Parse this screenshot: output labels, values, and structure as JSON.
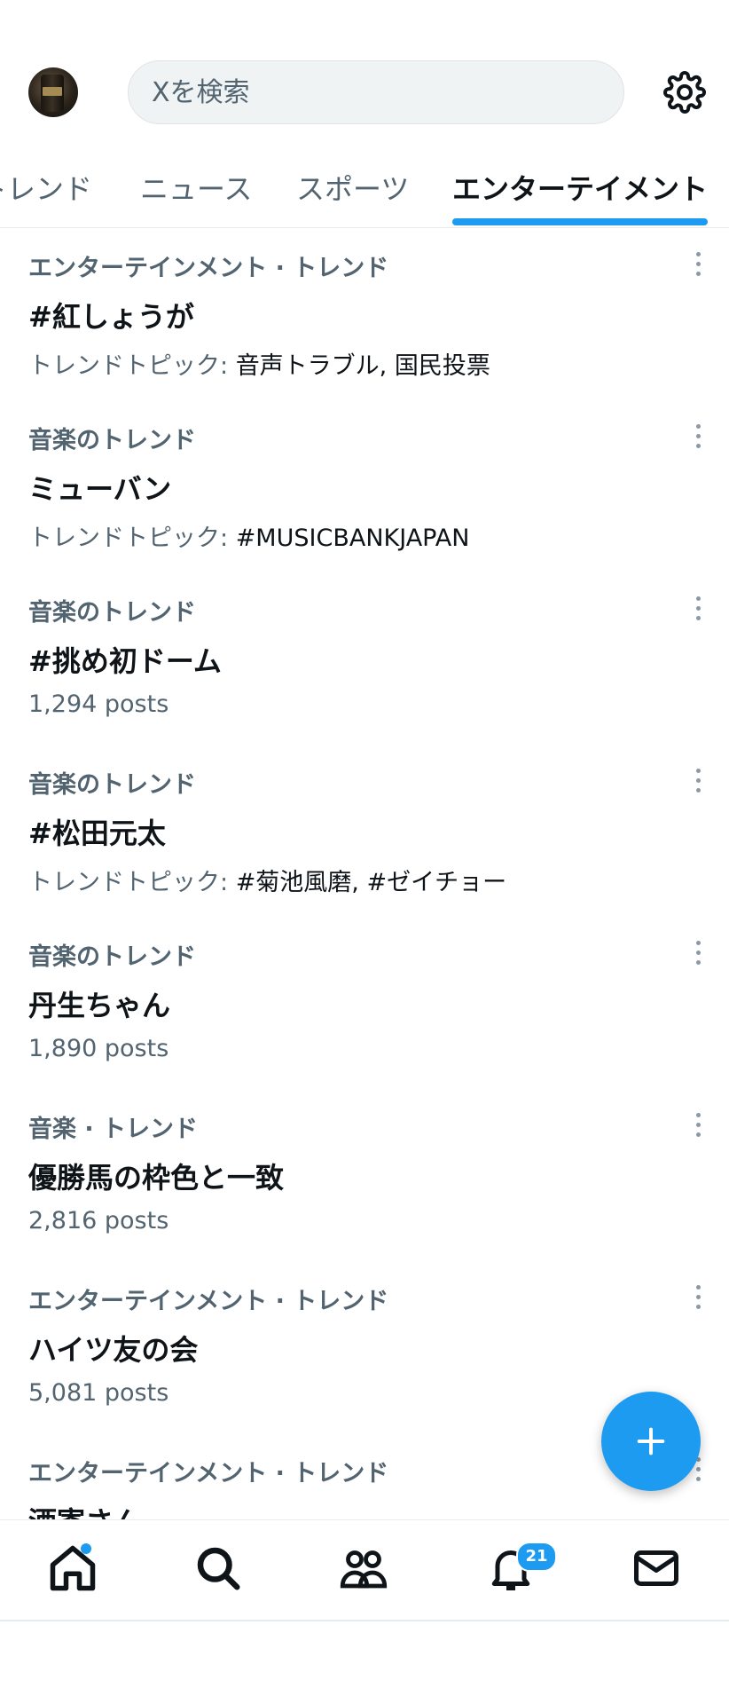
{
  "search": {
    "placeholder": "Xを検索"
  },
  "tabs": [
    {
      "label": "トレンド",
      "visible": "トレンド",
      "active": false
    },
    {
      "label": "ニュース",
      "active": false
    },
    {
      "label": "スポーツ",
      "active": false
    },
    {
      "label": "エンターテイメント",
      "active": true
    }
  ],
  "trends": [
    {
      "category": "エンターテインメント · トレンド",
      "name": "#紅しょうが",
      "meta_prefix": "トレンドトピック: ",
      "meta": "音声トラブル, 国民投票"
    },
    {
      "category": "音楽のトレンド",
      "name": "ミューバン",
      "meta_prefix": "トレンドトピック: ",
      "meta": "#MUSICBANKJAPAN"
    },
    {
      "category": "音楽のトレンド",
      "name": "#挑め初ドーム",
      "meta_prefix": "",
      "meta": "1,294 posts"
    },
    {
      "category": "音楽のトレンド",
      "name": "#松田元太",
      "meta_prefix": "トレンドトピック: ",
      "meta": "#菊池風磨, #ゼイチョー"
    },
    {
      "category": "音楽のトレンド",
      "name": "丹生ちゃん",
      "meta_prefix": "",
      "meta": "1,890 posts"
    },
    {
      "category": "音楽 · トレンド",
      "name": "優勝馬の枠色と一致",
      "meta_prefix": "",
      "meta": "2,816 posts"
    },
    {
      "category": "エンターテインメント · トレンド",
      "name": "ハイツ友の会",
      "meta_prefix": "",
      "meta": "5,081 posts"
    },
    {
      "category": "エンターテインメント · トレンド",
      "name": "酒寄さん",
      "meta_prefix": "",
      "meta": ""
    }
  ],
  "notifications": {
    "badge": "21"
  },
  "colors": {
    "accent": "#1d9bf0",
    "secondary_text": "#536471",
    "primary_text": "#0f1419"
  },
  "icons": {
    "settings": "gear-icon",
    "more": "more-vertical-icon",
    "compose": "plus-icon",
    "nav": [
      "home-icon",
      "search-icon",
      "communities-icon",
      "bell-icon",
      "mail-icon"
    ]
  }
}
